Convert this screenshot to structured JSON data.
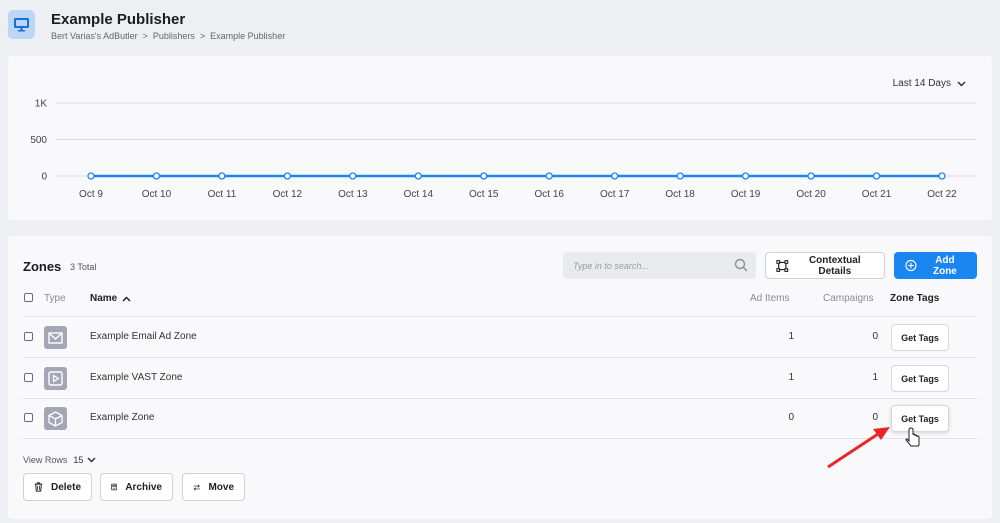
{
  "header": {
    "title": "Example Publisher",
    "breadcrumb": [
      "Bert Varias's AdButler",
      ">",
      "Publishers",
      ">",
      "Example Publisher"
    ]
  },
  "chart": {
    "range_label": "Last 14 Days"
  },
  "chart_data": {
    "type": "line",
    "x": [
      "Oct 9",
      "Oct 10",
      "Oct 11",
      "Oct 12",
      "Oct 13",
      "Oct 14",
      "Oct 15",
      "Oct 16",
      "Oct 17",
      "Oct 18",
      "Oct 19",
      "Oct 20",
      "Oct 21",
      "Oct 22"
    ],
    "series": [
      {
        "values": [
          0,
          0,
          0,
          0,
          0,
          0,
          0,
          0,
          0,
          0,
          0,
          0,
          0,
          0
        ]
      }
    ],
    "yticks": [
      0,
      500,
      1000
    ],
    "ytick_labels": [
      "0",
      "500",
      "1K"
    ],
    "ylim": [
      0,
      1000
    ],
    "grid": true,
    "color": "#1a86f2"
  },
  "zones": {
    "title": "Zones",
    "count": "3 Total",
    "search_placeholder": "Type in to search...",
    "contextual_label": "Contextual Details",
    "add_label": "Add Zone",
    "columns": {
      "type": "Type",
      "name": "Name",
      "ad_items": "Ad Items",
      "campaigns": "Campaigns",
      "zone_tags": "Zone Tags"
    },
    "rows": [
      {
        "icon": "email-icon",
        "name": "Example Email Ad Zone",
        "ad_items": "1",
        "campaigns": "0",
        "tags_label": "Get Tags"
      },
      {
        "icon": "video-play-icon",
        "name": "Example VAST Zone",
        "ad_items": "1",
        "campaigns": "1",
        "tags_label": "Get Tags"
      },
      {
        "icon": "cube-icon",
        "name": "Example Zone",
        "ad_items": "0",
        "campaigns": "0",
        "tags_label": "Get Tags"
      }
    ],
    "view_rows_label": "View Rows",
    "view_rows_value": "15",
    "delete_label": "Delete",
    "archive_label": "Archive",
    "move_label": "Move"
  },
  "colors": {
    "accent": "#1a86f2",
    "annotation_arrow": "#e8262a"
  }
}
